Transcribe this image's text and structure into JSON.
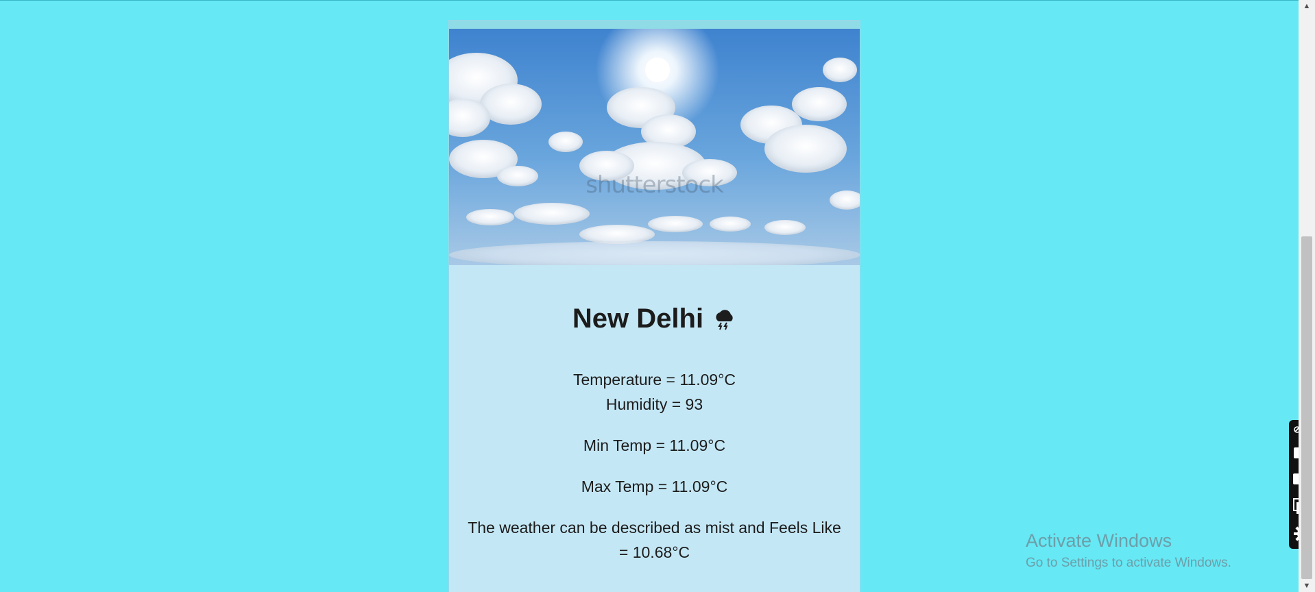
{
  "weather": {
    "city": "New Delhi",
    "temperature": "Temperature = 11.09°C",
    "humidity": "Humidity = 93",
    "min_temp": "Min Temp = 11.09°C",
    "max_temp": "Max Temp = 11.09°C",
    "description": "The weather can be described as mist and Feels Like = 10.68°C",
    "icon": "thunderstorm-cloud-icon"
  },
  "image": {
    "watermark": "shutterstock"
  },
  "tools": {
    "icons": [
      "link-icon",
      "more-icon",
      "camera-icon",
      "video-icon",
      "window-icon",
      "gear-icon"
    ]
  },
  "os_watermark": {
    "title": "Activate Windows",
    "subtitle": "Go to Settings to activate Windows."
  },
  "colors": {
    "page_background": "#66e8f5",
    "card_background": "#c4e7f5"
  }
}
